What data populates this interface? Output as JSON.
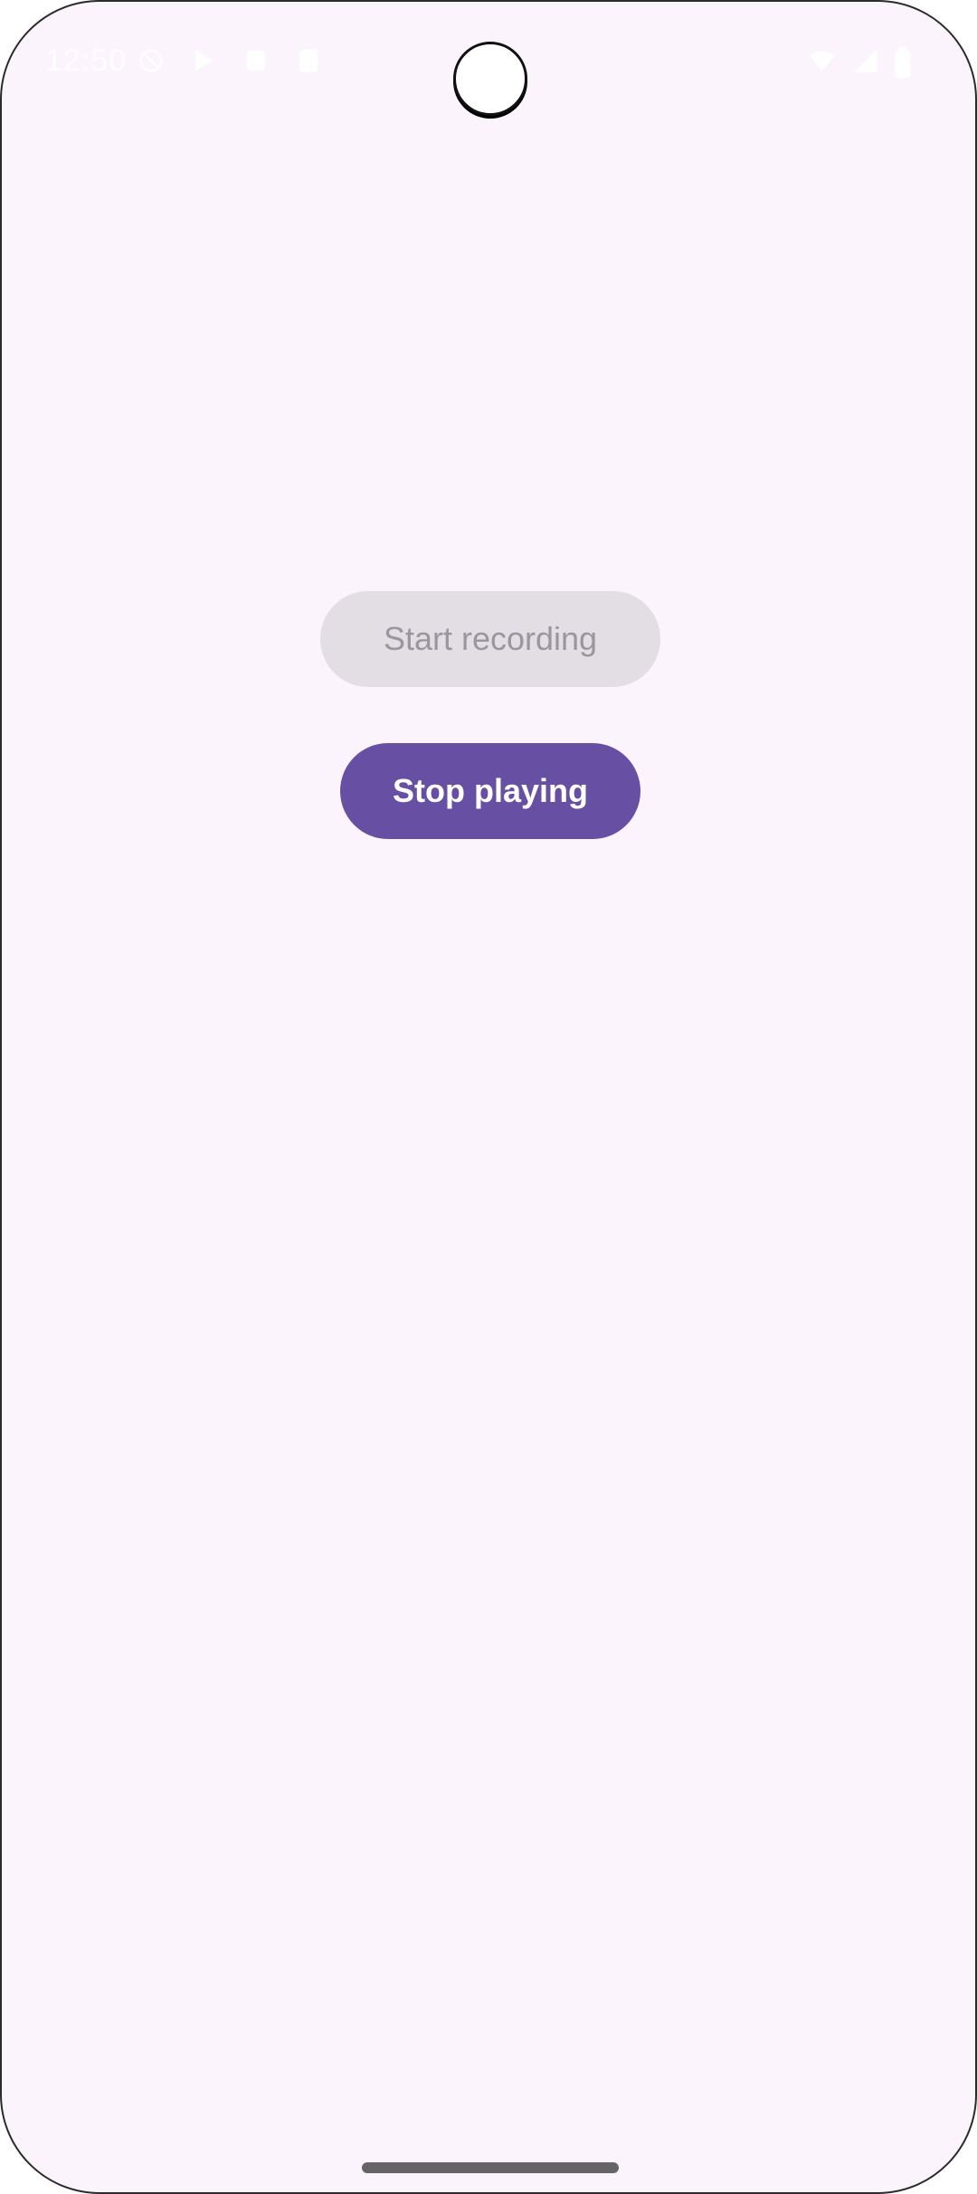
{
  "status_bar": {
    "time": "12:50",
    "left_icons": [
      "do-not-disturb-icon",
      "play-store-icon",
      "app-notification-icon",
      "sd-card-icon"
    ],
    "right_icons": [
      "wifi-icon",
      "signal-icon",
      "battery-icon"
    ]
  },
  "main": {
    "start_recording_label": "Start recording",
    "start_recording_enabled": false,
    "stop_playing_label": "Stop playing",
    "stop_playing_enabled": true
  },
  "colors": {
    "background": "#fcf4fc",
    "primary": "#6750a4",
    "disabled_bg": "#e3dde4",
    "disabled_text": "#9a969d"
  }
}
